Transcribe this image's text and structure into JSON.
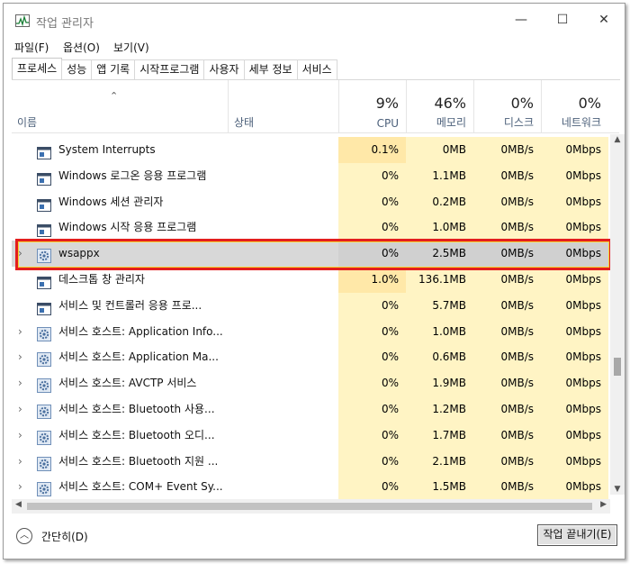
{
  "window": {
    "title": "작업 관리자",
    "minimize": "—",
    "maximize": "☐",
    "close": "✕"
  },
  "menu": [
    {
      "label": "파일(F)"
    },
    {
      "label": "옵션(O)"
    },
    {
      "label": "보기(V)"
    }
  ],
  "tabs": [
    {
      "label": "프로세스",
      "active": true
    },
    {
      "label": "성능"
    },
    {
      "label": "앱 기록"
    },
    {
      "label": "시작프로그램"
    },
    {
      "label": "사용자"
    },
    {
      "label": "세부 정보"
    },
    {
      "label": "서비스"
    }
  ],
  "columns": {
    "name": "이름",
    "status": "상태",
    "cpu": {
      "pct": "9%",
      "label": "CPU"
    },
    "memory": {
      "pct": "46%",
      "label": "메모리"
    },
    "disk": {
      "pct": "0%",
      "label": "디스크"
    },
    "network": {
      "pct": "0%",
      "label": "네트워크"
    }
  },
  "processes": [
    {
      "name": "System Interrupts",
      "icon": "window-icon",
      "expandable": false,
      "cpu": "0.1%",
      "mem": "0MB",
      "disk": "0MB/s",
      "net": "0Mbps"
    },
    {
      "name": "Windows 로그온 응용 프로그램",
      "icon": "window-icon",
      "expandable": false,
      "cpu": "0%",
      "mem": "1.1MB",
      "disk": "0MB/s",
      "net": "0Mbps"
    },
    {
      "name": "Windows 세션 관리자",
      "icon": "window-icon",
      "expandable": false,
      "cpu": "0%",
      "mem": "0.2MB",
      "disk": "0MB/s",
      "net": "0Mbps"
    },
    {
      "name": "Windows 시작 응용 프로그램",
      "icon": "window-icon",
      "expandable": false,
      "cpu": "0%",
      "mem": "1.0MB",
      "disk": "0MB/s",
      "net": "0Mbps"
    },
    {
      "name": "wsappx",
      "icon": "gear-icon",
      "expandable": true,
      "selected": true,
      "cpu": "0%",
      "mem": "2.5MB",
      "disk": "0MB/s",
      "net": "0Mbps"
    },
    {
      "name": "데스크톱 창 관리자",
      "icon": "window-icon",
      "expandable": false,
      "cpu": "1.0%",
      "mem": "136.1MB",
      "disk": "0MB/s",
      "net": "0Mbps"
    },
    {
      "name": "서비스 및 컨트롤러 응용 프로...",
      "icon": "window-icon",
      "expandable": false,
      "cpu": "0%",
      "mem": "5.7MB",
      "disk": "0MB/s",
      "net": "0Mbps"
    },
    {
      "name": "서비스 호스트: Application Info...",
      "icon": "gear-icon",
      "expandable": true,
      "cpu": "0%",
      "mem": "1.0MB",
      "disk": "0MB/s",
      "net": "0Mbps"
    },
    {
      "name": "서비스 호스트: Application Ma...",
      "icon": "gear-icon",
      "expandable": true,
      "cpu": "0%",
      "mem": "0.6MB",
      "disk": "0MB/s",
      "net": "0Mbps"
    },
    {
      "name": "서비스 호스트: AVCTP 서비스",
      "icon": "gear-icon",
      "expandable": true,
      "cpu": "0%",
      "mem": "1.9MB",
      "disk": "0MB/s",
      "net": "0Mbps"
    },
    {
      "name": "서비스 호스트: Bluetooth 사용...",
      "icon": "gear-icon",
      "expandable": true,
      "cpu": "0%",
      "mem": "1.2MB",
      "disk": "0MB/s",
      "net": "0Mbps"
    },
    {
      "name": "서비스 호스트: Bluetooth 오디...",
      "icon": "gear-icon",
      "expandable": true,
      "cpu": "0%",
      "mem": "1.7MB",
      "disk": "0MB/s",
      "net": "0Mbps"
    },
    {
      "name": "서비스 호스트: Bluetooth 지원 ...",
      "icon": "gear-icon",
      "expandable": true,
      "cpu": "0%",
      "mem": "2.1MB",
      "disk": "0MB/s",
      "net": "0Mbps"
    },
    {
      "name": "서비스 호스트: COM+ Event Sy...",
      "icon": "gear-icon",
      "expandable": true,
      "cpu": "0%",
      "mem": "1.5MB",
      "disk": "0MB/s",
      "net": "0Mbps"
    }
  ],
  "footer": {
    "collapse": "간단히(D)",
    "end_task": "작업 끝내기(E)"
  },
  "colors": {
    "highlight": "#e41e1e",
    "cpu_bg": "#fff4c4",
    "header_text": "#4c607a"
  }
}
